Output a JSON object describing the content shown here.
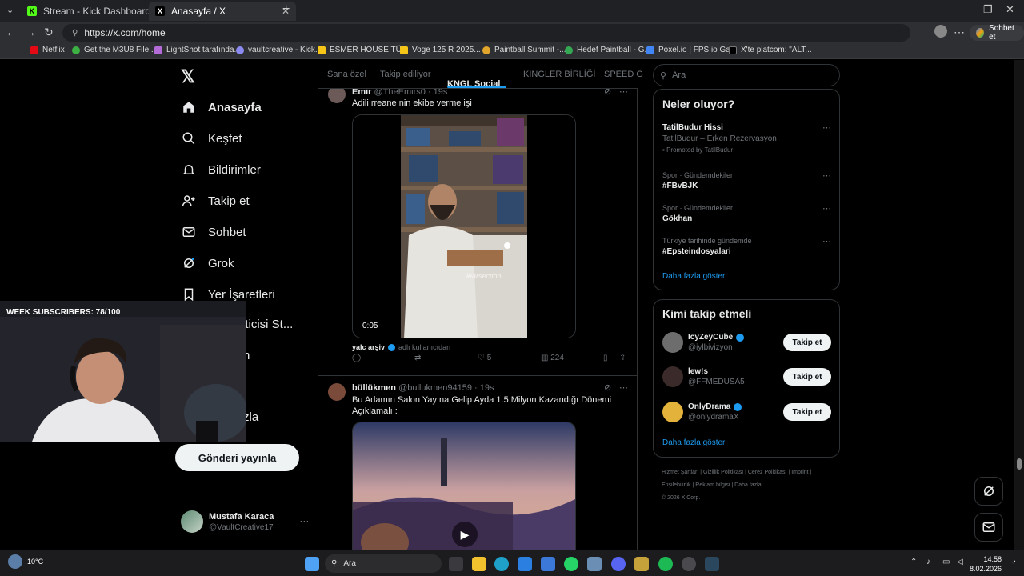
{
  "browser": {
    "tabs": [
      {
        "label": "Stream - Kick Dashboard",
        "active": false
      },
      {
        "label": "Anasayfa / X",
        "active": true
      }
    ],
    "url": "https://x.com/home",
    "profile_button": "Sohbet et",
    "bookmarks": [
      "Netflix",
      "Get the M3U8 File...",
      "LightShot tarafında...",
      "vaultcreative - Kick...",
      "ESMER HOUSE TÜ...",
      "Voge 125 R 2025...",
      "Paintball Summit -...",
      "Hedef Paintball - G...",
      "Poxel.io | FPS io Ga...",
      "X'te platcom: \"ALT..."
    ]
  },
  "nav": {
    "items": [
      "Anasayfa",
      "Keşfet",
      "Bildirimler",
      "Takip et",
      "Sohbet",
      "Grok",
      "Yer İşaretleri",
      "eticisi St...",
      "n",
      "zla"
    ],
    "post_button": "Gönderi yayınla",
    "profile_name": "Mustafa Karaca",
    "profile_handle": "@VaultCreative17"
  },
  "feed": {
    "tabs": [
      "Sana özel",
      "Takip ediliyor",
      "KNGL Social",
      "KINGLER BİRLİĞİ",
      "SPEED G"
    ],
    "tweet1": {
      "author": "Emir",
      "handle": "@TheEmirs0 · 19s",
      "text": "Adili rreane nin ekibe verme işi",
      "video_time": "0:05",
      "watermark": "learsection",
      "reply_author": "yalc arşiv",
      "reply_note": "adlı kullanıcıdan",
      "likes": "5",
      "views": "224"
    },
    "tweet2": {
      "author": "büllükmen",
      "handle": "@bullukmen94159 · 19s",
      "text": "Bu Adamın Salon Yayına Gelip Ayda 1.5 Milyon Kazandığı Dönemi Açıklamalı :"
    }
  },
  "right": {
    "search_placeholder": "Ara",
    "trends_title": "Neler oluyor?",
    "trends": [
      {
        "title": "TatilBudur Hissi",
        "sub": "TatilBudur – Erken Rezervasyon",
        "promo": "Promoted by TatilBudur"
      },
      {
        "category": "Spor · Gündemdekiler",
        "title": "#FBvBJK"
      },
      {
        "category": "Spor · Gündemdekiler",
        "title": "Gökhan"
      },
      {
        "category": "Türkiye tarihinde gündemde",
        "title": "#Epsteindosyalari"
      }
    ],
    "show_more": "Daha fazla göster",
    "who_title": "Kimi takip etmeli",
    "who": [
      {
        "name": "IcyZeyCube",
        "handle": "@iylbivizyon",
        "button": "Takip et"
      },
      {
        "name": "lew!s",
        "handle": "@FFMEDUSA5",
        "button": "Takip et"
      },
      {
        "name": "OnlyDrama",
        "handle": "@onlydramaX",
        "button": "Takip et"
      }
    ],
    "who_more": "Daha fazla göster",
    "footer": "Hizmet Şartları | Gizlilik Politikası | Çerez Politikası | Imprint | Erişilebilirlik | Reklam bilgisi | Daha fazla ...",
    "copyright": "© 2026 X Corp."
  },
  "overlay": {
    "subs": "WEEK SUBSCRIBERS: 78/100"
  },
  "taskbar": {
    "weather": "10°C",
    "search": "Ara",
    "time": "14:58",
    "date": "8.02.2026"
  }
}
